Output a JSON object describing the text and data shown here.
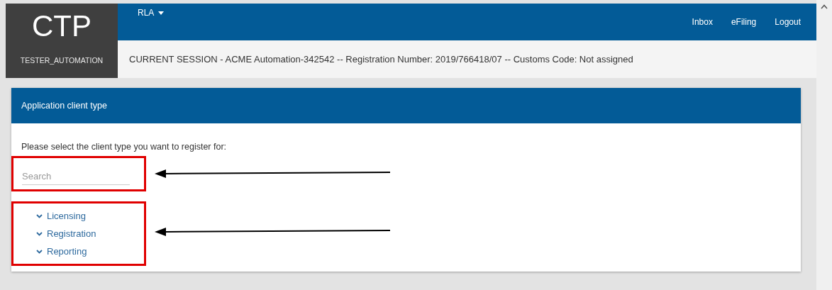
{
  "header": {
    "logo": "CTP",
    "username": "TESTER_AUTOMATION",
    "menu": {
      "label": "RLA"
    },
    "links": [
      "Inbox",
      "eFiling",
      "Logout"
    ],
    "session": "CURRENT SESSION - ACME Automation-342542 -- Registration Number: 2019/766418/07 -- Customs Code: Not assigned"
  },
  "panel": {
    "title": "Application client type",
    "prompt": "Please select the client type you want to register for:",
    "search": {
      "placeholder": "Search"
    },
    "client_types": [
      {
        "label": "Licensing"
      },
      {
        "label": "Registration"
      },
      {
        "label": "Reporting"
      }
    ]
  }
}
